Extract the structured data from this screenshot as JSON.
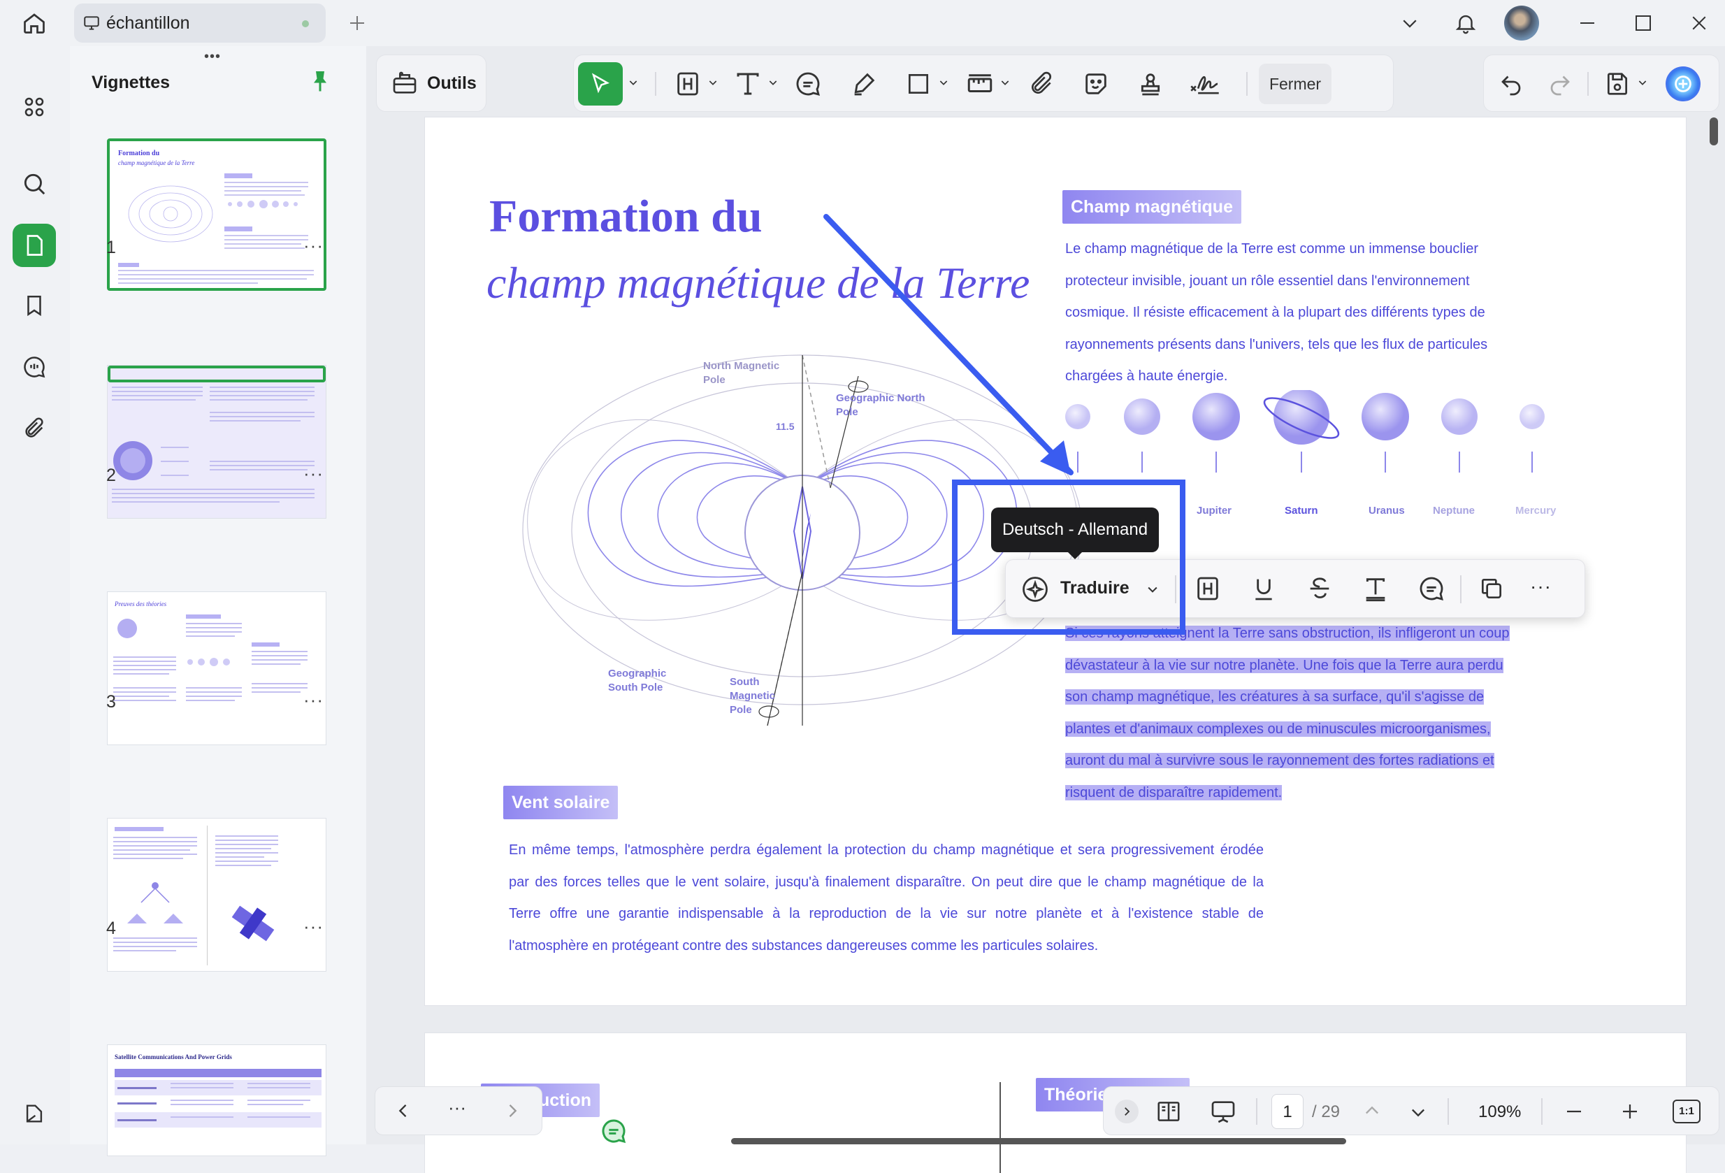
{
  "titlebar": {
    "tab_label": "échantillon",
    "home_icon": "home-icon",
    "add_tab_icon": "plus-icon"
  },
  "sidebar": {
    "panel_title": "Vignettes",
    "drag_handle": "•••",
    "rail_icons": [
      "grid-icon",
      "search-icon",
      "pages-icon",
      "bookmark-icon",
      "comment-icon",
      "attachment-icon",
      "layers-icon"
    ],
    "thumbnails": [
      {
        "number": "1",
        "title_line1": "Formation du",
        "title_line2": "champ magnétique de la Terre"
      },
      {
        "number": "2"
      },
      {
        "number": "3",
        "title_line1": "Preuves des théories"
      },
      {
        "number": "4"
      },
      {
        "number": "5",
        "title_line1": "Satellite Communications And Power Grids"
      }
    ],
    "more": "···"
  },
  "toolbar": {
    "tools_label": "Outils",
    "close_label": "Fermer"
  },
  "page": {
    "title_line1": "Formation du",
    "title_line2": "champ magnétique de la Terre",
    "section1_tag": "Champ magnétique",
    "section1_text": [
      "Le champ magnétique de la Terre est comme un immense bouclier",
      "protecteur invisible, jouant un rôle essentiel dans l'environnement",
      "cosmique. Il résiste efficacement à la plupart des différents types de",
      "rayonnements présents dans l'univers, tels que les flux de particules",
      "chargées à haute énergie."
    ],
    "planets": [
      "Jupiter",
      "Saturn",
      "Uranus",
      "Neptune",
      "Mercury"
    ],
    "diagram_labels": {
      "north_magnetic": "North Magnetic Pole",
      "geo_north": "Geographic North Pole",
      "geo_south": "Geographic South Pole",
      "south_magnetic": "South Magnetic Pole",
      "angle": "11.5"
    },
    "highlight_text": [
      "Si ces rayons atteignent la Terre sans obstruction, ils infligeront un coup",
      "dévastateur à la vie sur notre planète. Une fois que la Terre aura perdu",
      "son champ magnétique, les créatures à sa surface, qu'il s'agisse de",
      "plantes et d'animaux complexes ou de minuscules microorganismes,",
      "auront du mal à survivre sous le rayonnement des fortes radiations et",
      "risquent de disparaître rapidement."
    ],
    "section2_tag": "Vent solaire",
    "section2_text": [
      "En même temps, l'atmosphère perdra également la protection du champ magnétique et sera progressivement érodée",
      "par des forces telles que le vent solaire, jusqu'à finalement disparaître. On peut dire que le champ magnétique de la",
      "Terre offre une garantie indispensable à la reproduction de la vie sur notre planète et à l'existence stable de",
      "l'atmosphère en protégeant contre des substances dangereuses comme les particules solaires."
    ]
  },
  "page2": {
    "tag1": "uction",
    "tag2": "Théorie"
  },
  "floating_toolbar": {
    "translate_label": "Traduire",
    "tooltip": "Deutsch - Allemand",
    "more": "···"
  },
  "navigation": {
    "current_page": "1",
    "total_pages": "/ 29",
    "zoom": "109%",
    "fit_label": "1:1",
    "dots": "···"
  },
  "colors": {
    "accent": "#2aa34a",
    "document_text": "#4c48d8",
    "highlight": "#b6b0f4",
    "annotation_blue": "#3a5cf0"
  }
}
